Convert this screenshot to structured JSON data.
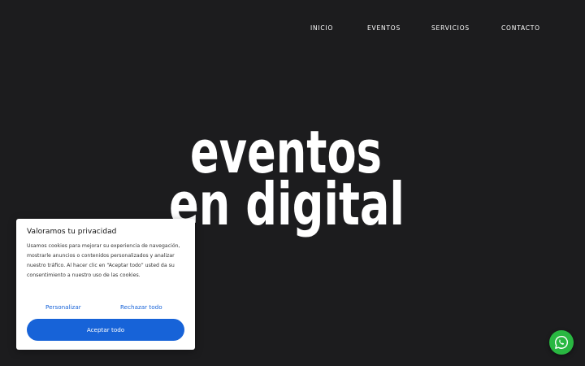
{
  "nav": {
    "items": [
      "INICIO",
      "EVENTOS",
      "SERVICIOS",
      "CONTACTO"
    ]
  },
  "hero": {
    "line1": "eventos",
    "line2": "en digital"
  },
  "cookie": {
    "title": "Valoramos tu privacidad",
    "text": "Usamos cookies para mejorar su experiencia de navegación, mostrarle anuncios o contenidos personalizados y analizar nuestro tráfico. Al hacer clic en “Aceptar todo” usted da su consentimiento a nuestro uso de las cookies.",
    "customize_label": "Personalizar",
    "reject_label": "Rechazar todo",
    "accept_label": "Aceptar todo"
  },
  "whatsapp": {
    "icon": "whatsapp-icon",
    "color": "#29b741"
  },
  "colors": {
    "background": "#1c1c1e",
    "accent": "#1763d8"
  }
}
